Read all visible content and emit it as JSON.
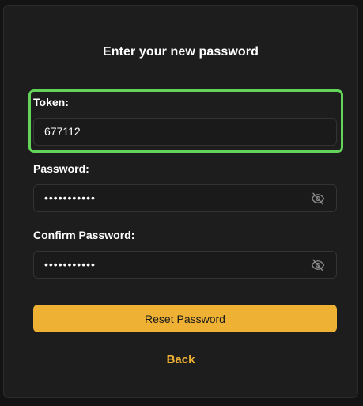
{
  "form": {
    "title": "Enter your new password",
    "token_label": "Token:",
    "token_value": "677112",
    "password_label": "Password:",
    "password_value": "•••••••••••",
    "confirm_label": "Confirm Password:",
    "confirm_value": "•••••••••••",
    "reset_label": "Reset Password",
    "back_label": "Back"
  },
  "icons": {
    "password_toggle": "eye-off-icon",
    "confirm_toggle": "eye-off-icon"
  },
  "colors": {
    "accent": "#efb134",
    "highlight": "#63d35a",
    "card": "#1d1d1d",
    "background": "#131313"
  }
}
